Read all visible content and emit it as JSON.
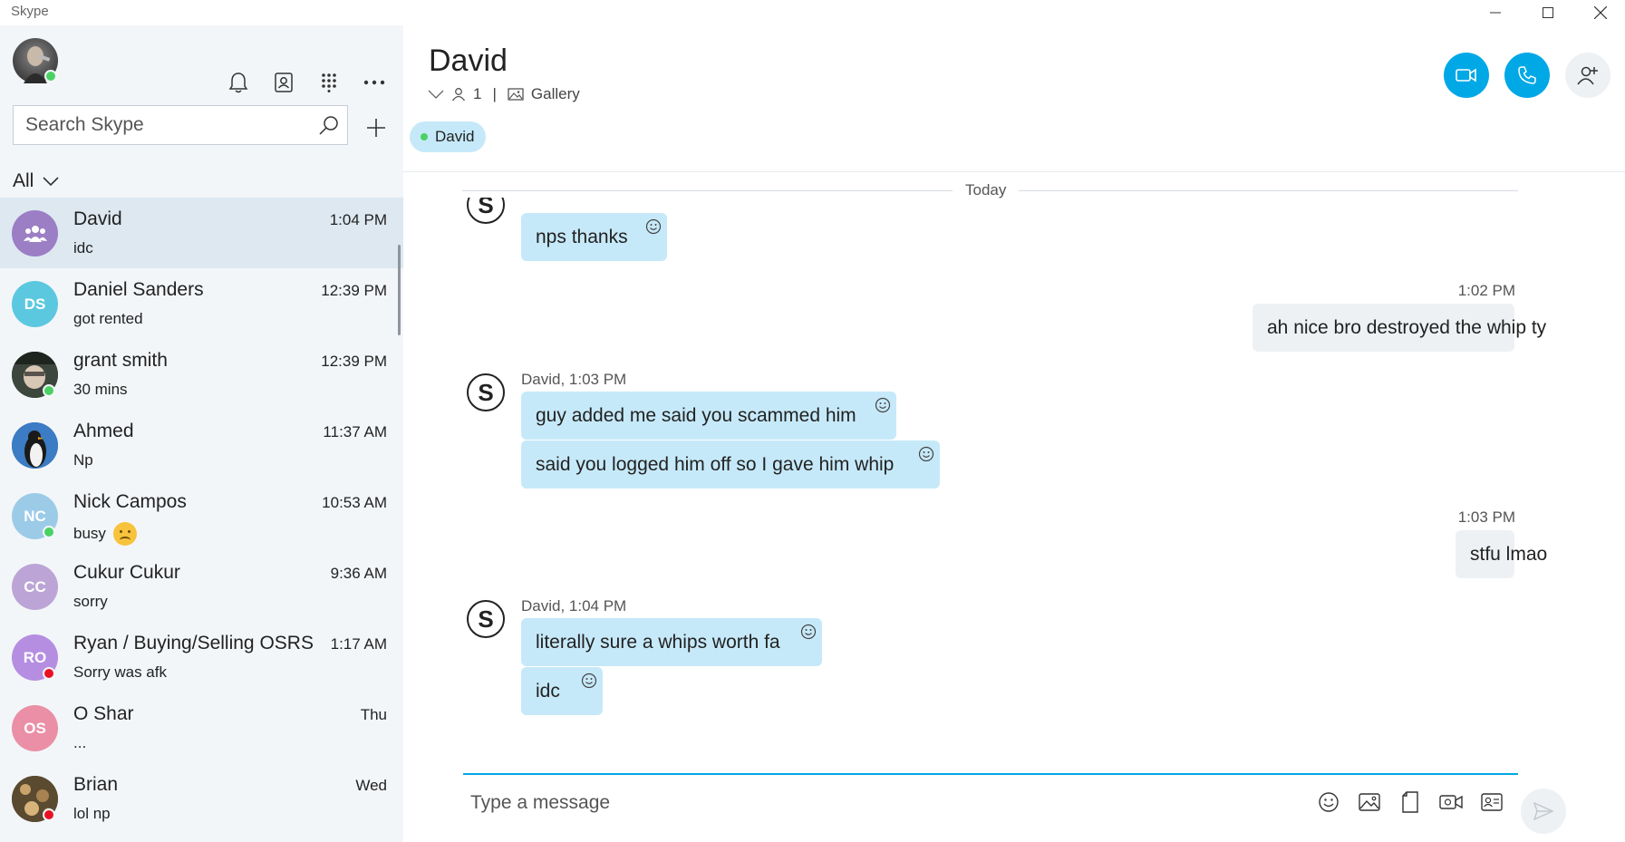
{
  "window": {
    "title": "Skype"
  },
  "sidebar": {
    "search": {
      "placeholder": "Search Skype"
    },
    "filter": {
      "label": "All"
    },
    "chats": [
      {
        "name": "David",
        "preview": "idc",
        "time": "1:04 PM",
        "avatar_initials": "",
        "avatar_color": "#9b7ec4",
        "avatar_type": "group",
        "presence": "none",
        "active": true
      },
      {
        "name": "Daniel Sanders",
        "preview": "got rented",
        "time": "12:39 PM",
        "avatar_initials": "DS",
        "avatar_color": "#5bc8df",
        "avatar_type": "initials",
        "presence": "none"
      },
      {
        "name": "grant smith",
        "preview": "30 mins",
        "time": "12:39 PM",
        "avatar_initials": "",
        "avatar_color": "#556655",
        "avatar_type": "photo",
        "presence": "online"
      },
      {
        "name": "Ahmed",
        "preview": "Np",
        "time": "11:37 AM",
        "avatar_initials": "",
        "avatar_color": "#2e6fb0",
        "avatar_type": "photo",
        "presence": "none"
      },
      {
        "name": "Nick Campos",
        "preview": "busy",
        "time": "10:53 AM",
        "avatar_initials": "NC",
        "avatar_color": "#9ccbe8",
        "avatar_type": "initials",
        "presence": "online",
        "preview_emoji": "sad-face"
      },
      {
        "name": "Cukur Cukur",
        "preview": "sorry",
        "time": "9:36 AM",
        "avatar_initials": "CC",
        "avatar_color": "#bca4d6",
        "avatar_type": "initials",
        "presence": "none"
      },
      {
        "name": "Ryan / Buying/Selling OSRS",
        "preview": "Sorry was afk",
        "time": "1:17 AM",
        "avatar_initials": "RO",
        "avatar_color": "#b58ee2",
        "avatar_type": "initials",
        "presence": "busy"
      },
      {
        "name": "O Shar",
        "preview": "...",
        "time": "Thu",
        "avatar_initials": "OS",
        "avatar_color": "#ea8fa6",
        "avatar_type": "initials",
        "presence": "none"
      },
      {
        "name": "Brian",
        "preview": "lol np",
        "time": "Wed",
        "avatar_initials": "",
        "avatar_color": "#6b5a3e",
        "avatar_type": "photo",
        "presence": "busy"
      }
    ]
  },
  "conversation": {
    "title": "David",
    "participant_count": "1",
    "separator": "|",
    "gallery_label": "Gallery",
    "participant_chip": "David",
    "day_label": "Today",
    "messages": {
      "m1": "nps thanks",
      "t2": "1:02 PM",
      "m2": "ah nice bro destroyed the whip ty",
      "s3": "David, 1:03 PM",
      "m3": "guy added me said you scammed him",
      "m4": "said you logged him off so I gave him whip",
      "t5": "1:03 PM",
      "m5": "stfu lmao",
      "s6": "David, 1:04 PM",
      "m6": "literally sure a whips worth fa",
      "m7": "idc"
    },
    "compose": {
      "placeholder": "Type a message"
    }
  },
  "colors": {
    "accent": "#00a8e6",
    "incoming_bubble": "#c6e9f9",
    "outgoing_bubble": "#eef1f4",
    "sidebar_bg": "#f3f6f9",
    "active_chat_bg": "#dde8f1"
  }
}
